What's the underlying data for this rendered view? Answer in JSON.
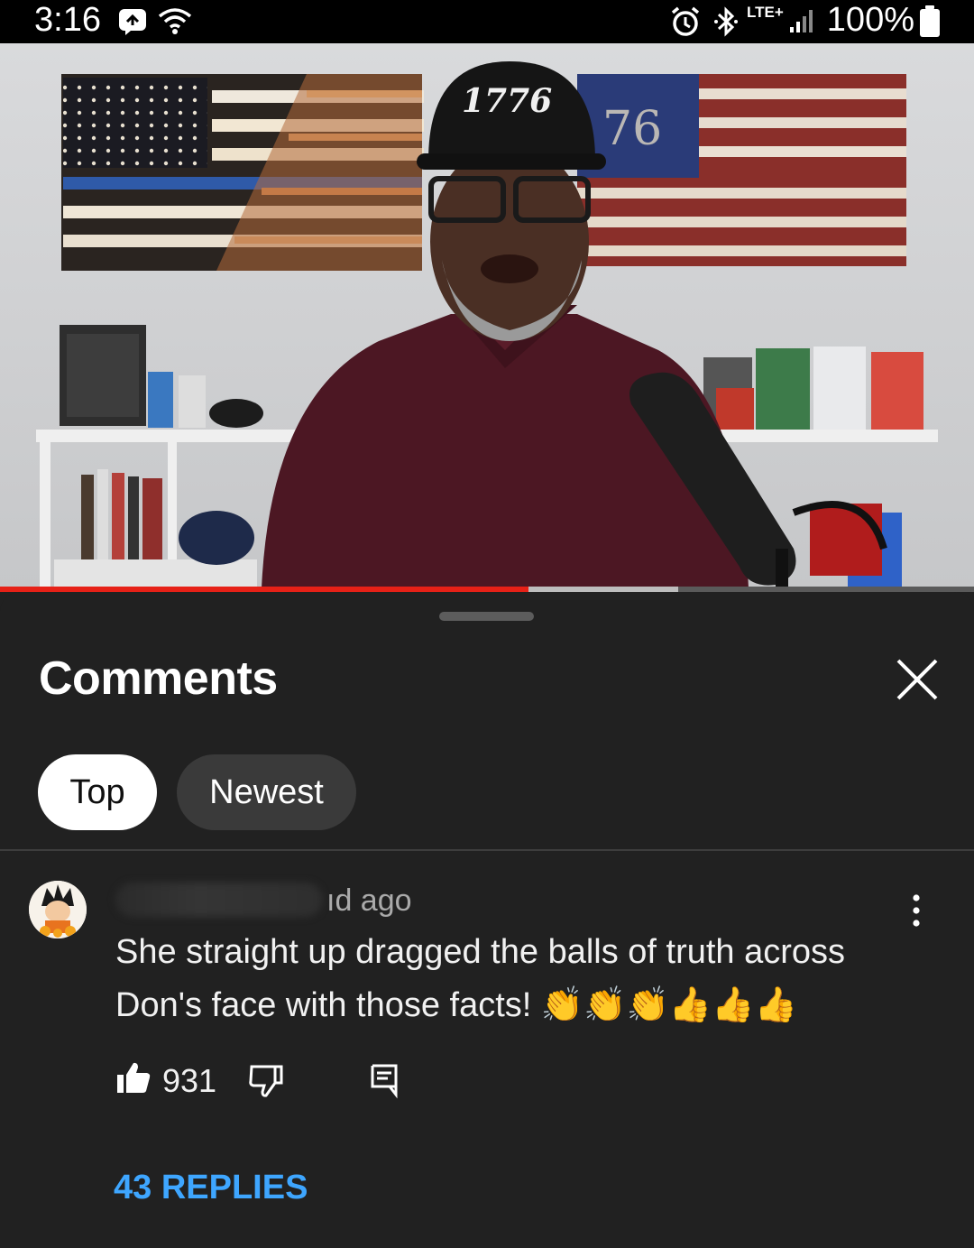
{
  "status_bar": {
    "time": "3:16",
    "network": "LTE+",
    "battery": "100%",
    "icons": [
      "message-icon",
      "wifi-icon",
      "alarm-icon",
      "bluetooth-icon",
      "signal-icon",
      "battery-icon"
    ]
  },
  "video": {
    "progress_played": 0.543,
    "progress_buffered": 0.696,
    "cap_text": "1776",
    "flag_text": "76"
  },
  "comments": {
    "title": "Comments",
    "sort_chips": [
      {
        "label": "Top",
        "selected": true
      },
      {
        "label": "Newest",
        "selected": false
      }
    ],
    "items": [
      {
        "meta": "ıd ago",
        "text": "She straight up dragged the balls of truth across Don's face with those facts! 👏👏👏👍👍👍",
        "likes": "931",
        "replies_label": "43 REPLIES"
      }
    ]
  },
  "colors": {
    "background": "#212121",
    "progress": "#e62117",
    "link": "#3ea6ff"
  }
}
